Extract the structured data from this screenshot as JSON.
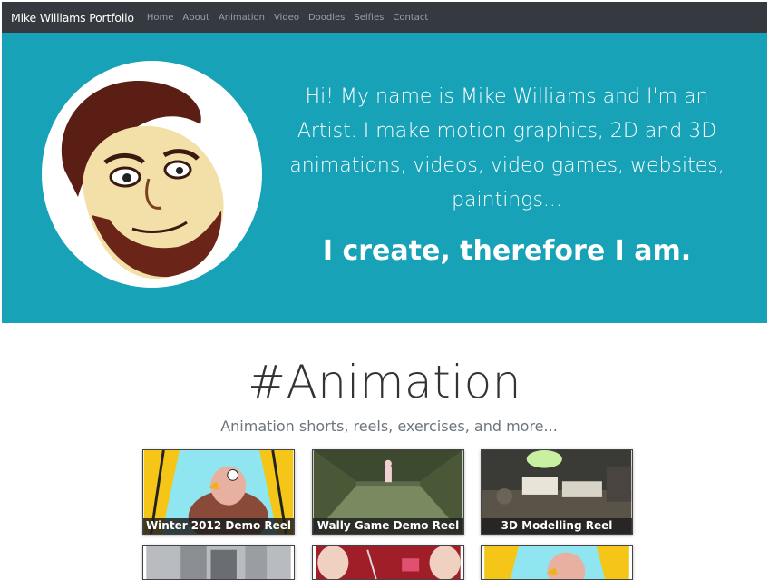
{
  "navbar": {
    "brand": "Mike Williams Portfolio",
    "links": [
      "Home",
      "About",
      "Animation",
      "Video",
      "Doodles",
      "Selfies",
      "Contact"
    ]
  },
  "hero": {
    "intro": "Hi! My name is Mike Williams and I'm an Artist. I make motion graphics, 2D and 3D animations, videos, video games, websites, paintings...",
    "motto": "I create, therefore I am.",
    "background_color": "#18a2b8"
  },
  "section": {
    "title": "#Animation",
    "subtitle": "Animation shorts, reels, exercises, and more..."
  },
  "thumbnails": [
    {
      "label": "Winter 2012 Demo Reel",
      "icon": "turkey-cartoon-icon"
    },
    {
      "label": "Wally Game Demo Reel",
      "icon": "game-corridor-icon"
    },
    {
      "label": "3D Modelling Reel",
      "icon": "desk-lamp-scene-icon"
    },
    {
      "label": "",
      "icon": "robot-statue-icon"
    },
    {
      "label": "",
      "icon": "theater-cartoon-icon"
    },
    {
      "label": "",
      "icon": "turkey-cartoon-icon"
    }
  ]
}
